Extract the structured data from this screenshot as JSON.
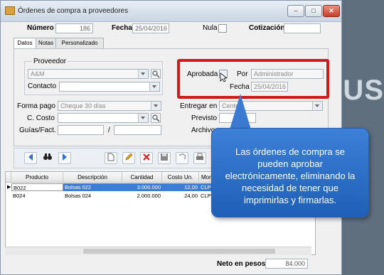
{
  "window": {
    "title": "Órdenes de compra a proveedores",
    "min": "–",
    "max": "□",
    "close": "✕"
  },
  "header": {
    "numero_label": "Número",
    "numero_value": "186",
    "fecha_label": "Fecha",
    "fecha_value": "25/04/2016",
    "nula_label": "Nula",
    "cotizacion_label": "Cotización",
    "cotizacion_value": ""
  },
  "tabs": [
    "Datos",
    "Notas",
    "Personalizado"
  ],
  "proveedor": {
    "group_label": "Proveedor",
    "value": "A&M",
    "contacto_label": "Contacto",
    "contacto_value": ""
  },
  "aprobacion": {
    "aprobada_label": "Aprobada",
    "por_label": "Por",
    "por_value": "Administrador",
    "fecha_label": "Fecha",
    "fecha_value": "25/04/2016"
  },
  "pago": {
    "forma_label": "Forma pago",
    "forma_value": "Cheque 30 días",
    "costo_label": "C. Costo",
    "costo_value": "",
    "guias_label": "Guías/Fact.",
    "guias_value1": "",
    "sep": "/",
    "guias_value2": ""
  },
  "entrega": {
    "entregar_label": "Entregar en",
    "entregar_value": "Central",
    "previsto_label": "Previsto",
    "previsto_value": "",
    "archivos_label": "Archivos"
  },
  "toolbar": {
    "icons": [
      "nav-prev-icon",
      "binoculars-icon",
      "nav-next-icon",
      "new-icon",
      "edit-icon",
      "delete-icon",
      "save-icon",
      "undo-icon",
      "print-icon"
    ]
  },
  "grid": {
    "columns": [
      "Producto",
      "Descripción",
      "Cantidad",
      "Costo Un.",
      "Mone"
    ],
    "rows": [
      {
        "producto": "B022",
        "descripcion": "Bolsas 022",
        "cantidad": "3.000.000",
        "costo": "12,00",
        "moneda": "CLP"
      },
      {
        "producto": "B024",
        "descripcion": "Bolsas 024",
        "cantidad": "2.000.000",
        "costo": "24,00",
        "moneda": "CLP"
      }
    ]
  },
  "footer": {
    "neto_label": "Neto en pesos",
    "neto_value": "84.000"
  },
  "tooltip": {
    "text": "Las órdenes de compra se pueden aprobar electrónicamente, eliminando la necesidad de tener que imprimirlas y firmarlas."
  },
  "background": {
    "text": "OUS"
  },
  "colors": {
    "highlight": "#d01919",
    "tooltip": "#2f6fc7",
    "selection": "#3d7dd6"
  }
}
